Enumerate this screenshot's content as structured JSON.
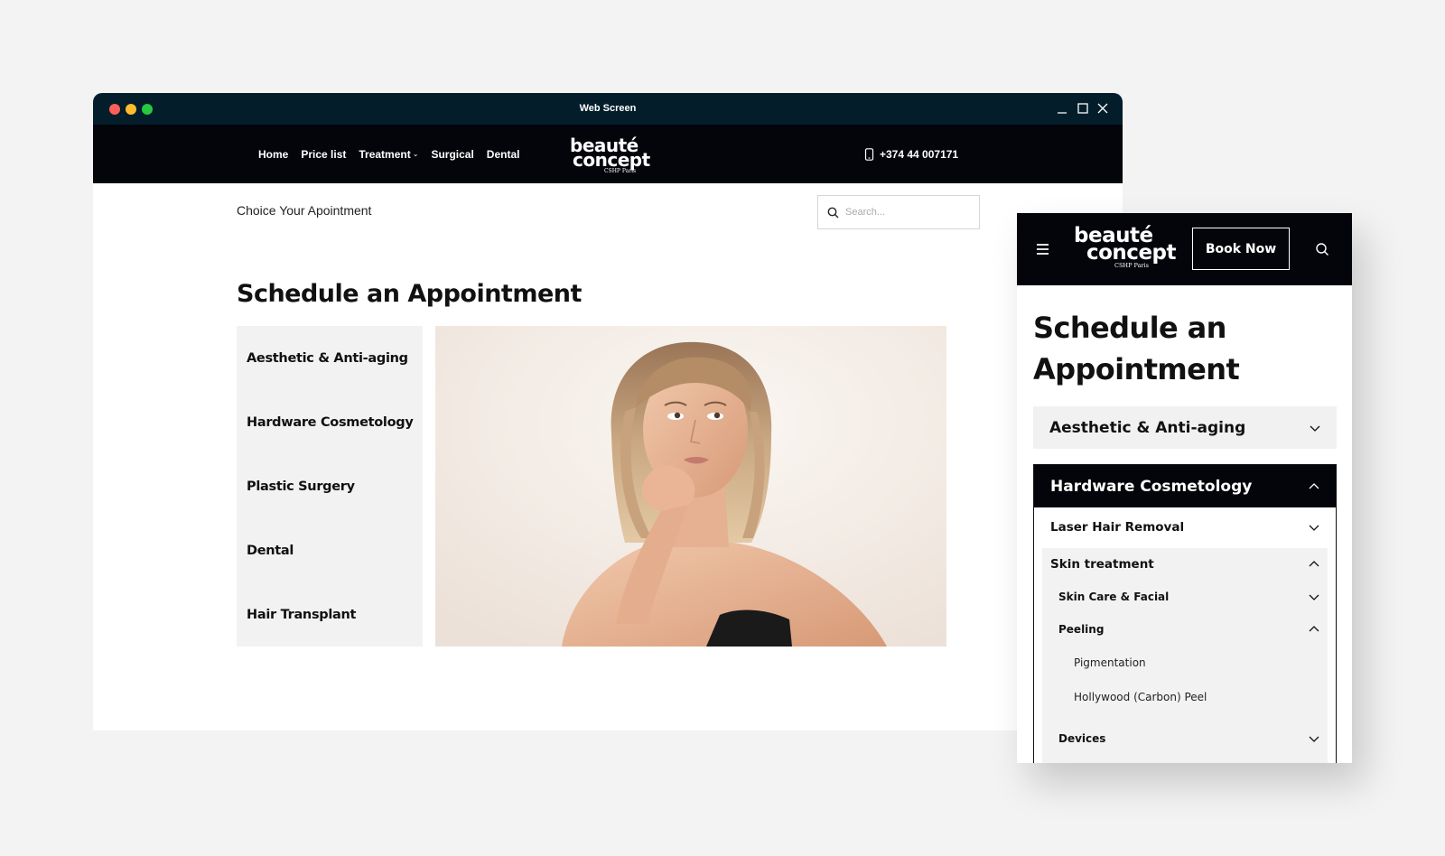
{
  "window": {
    "title": "Web Screen",
    "controls": [
      "minimize-icon",
      "maximize-icon",
      "close-icon"
    ]
  },
  "nav": {
    "links": [
      "Home",
      "Price list",
      "Treatment",
      "Surgical",
      "Dental"
    ],
    "treatment_caret": "⌄",
    "phone": "+374 44 007171"
  },
  "logo": {
    "line1": "beauté",
    "line2": "concept",
    "line3": "CSHP Paris"
  },
  "desktop": {
    "choice_label": "Choice Your Apointment",
    "search_placeholder": "Search...",
    "heading": "Schedule an Appointment",
    "categories": [
      "Aesthetic & Anti-aging",
      "Hardware Cosmetology",
      "Plastic Surgery",
      "Dental",
      "Hair Transplant"
    ]
  },
  "mobile": {
    "book_now": "Book Now",
    "heading_line1": "Schedule an",
    "heading_line2": "Appointment",
    "accordion": {
      "collapsed": "Aesthetic & Anti-aging",
      "expanded": "Hardware Cosmetology",
      "laser": "Laser Hair Removal",
      "skin_treatment": "Skin treatment",
      "skin_care": "Skin Care & Facial",
      "peeling": "Peeling",
      "pigmentation": "Pigmentation",
      "hollywood": "Hollywood (Carbon) Peel",
      "devices": "Devices"
    }
  },
  "colors": {
    "titlebar": "#031d2b",
    "nav_bg": "#04050b",
    "panel_bg": "#f2f2f2"
  }
}
